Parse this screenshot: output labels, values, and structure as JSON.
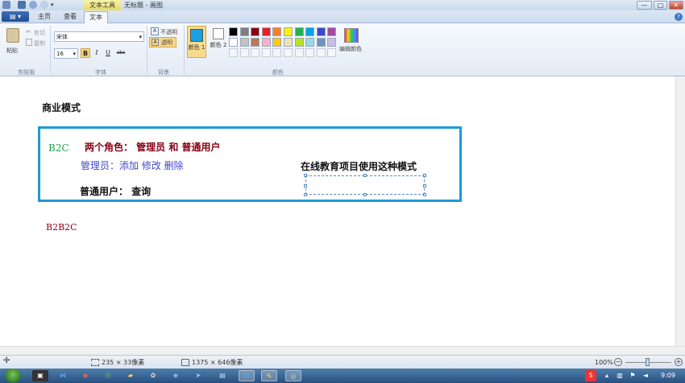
{
  "window": {
    "contextual_tab": "文本工具",
    "title": "无标题 - 画图",
    "min": "—",
    "max": "□",
    "close": "✕"
  },
  "tabs": {
    "file": "▤ ▾",
    "home": "主页",
    "view": "查看",
    "text": "文本"
  },
  "ribbon": {
    "clipboard": {
      "paste": "粘贴",
      "cut": "剪切",
      "copy": "复制",
      "group": "剪贴板"
    },
    "font": {
      "family": "宋体",
      "size": "16",
      "bold": "B",
      "italic": "I",
      "underline": "U",
      "strike": "abc",
      "group": "字体"
    },
    "background": {
      "opaque": "不透明",
      "transparent": "透明",
      "group": "背景"
    },
    "colors": {
      "color1_label": "颜色 1",
      "color2_label": "颜色 2",
      "edit": "编辑颜色",
      "group": "颜色",
      "color1": "#1ba1e2",
      "color2": "#ffffff",
      "palette_row1": [
        "#000000",
        "#7f7f7f",
        "#880015",
        "#ed1c24",
        "#ff7f27",
        "#fff200",
        "#22b14c",
        "#00a2e8",
        "#3f48cc",
        "#a349a4"
      ],
      "palette_row2": [
        "#ffffff",
        "#c3c3c3",
        "#b97a57",
        "#ffaec9",
        "#ffc90e",
        "#efe4b0",
        "#b5e61d",
        "#99d9ea",
        "#7092be",
        "#c8bfe7"
      ]
    }
  },
  "canvas": {
    "heading": "商业模式",
    "b2c": "B2C",
    "roles": "两个角色：  管理员  和  普通用户",
    "admin_line": "管理员：添加  修改  删除",
    "user_line": "普通用户：  查询",
    "note": "在线教育项目使用这种模式",
    "b2b2c": "B2B2C"
  },
  "status": {
    "selection": "235 × 33像素",
    "canvas_size": "1375 × 646像素",
    "zoom": "100%"
  },
  "taskbar": {
    "clock": "9:09"
  }
}
